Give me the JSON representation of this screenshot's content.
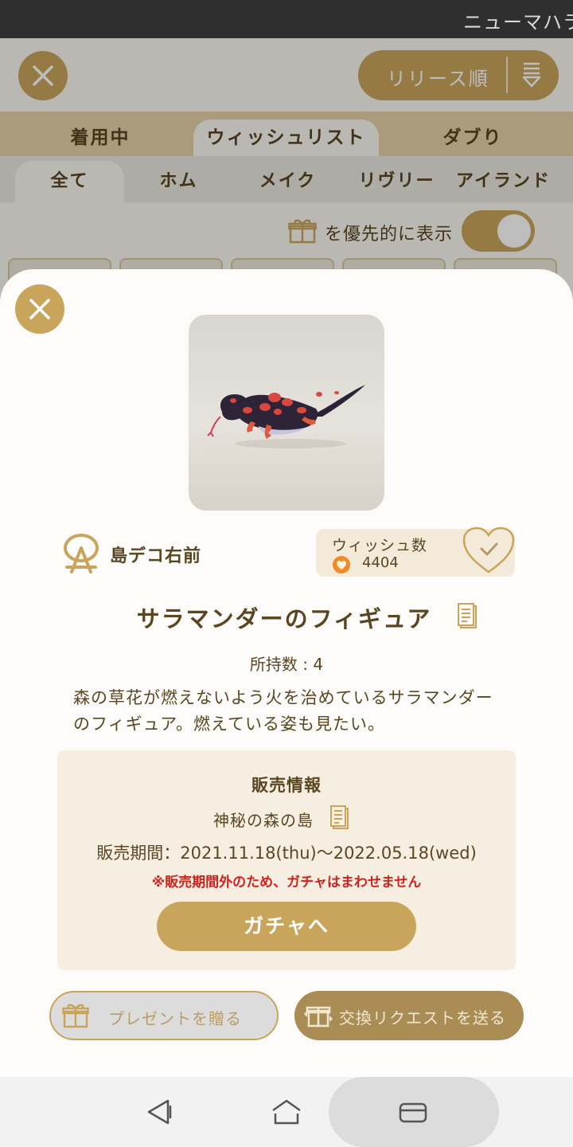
{
  "status_bar": {
    "text": "ニューマハラ"
  },
  "background": {
    "sort_label": "リリース順",
    "main_tabs": [
      {
        "label": "着用中"
      },
      {
        "label": "ウィッシュリスト"
      },
      {
        "label": "ダブり"
      }
    ],
    "sub_tabs": [
      {
        "label": "全て"
      },
      {
        "label": "ホム"
      },
      {
        "label": "メイク"
      },
      {
        "label": "リヴリー"
      },
      {
        "label": "アイランド"
      }
    ],
    "priority_label": "を優先的に表示",
    "priority_toggle_on": true
  },
  "item": {
    "category": "島デコ右前",
    "wish_label": "ウィッシュ数",
    "wish_count": "4404",
    "title": "サラマンダーのフィギュア",
    "owned": "所持数 : 4",
    "description": "森の草花が燃えないよう火を治めているサラマンダーのフィギュア。燃えている姿も見たい。"
  },
  "sale": {
    "heading": "販売情報",
    "place": "神秘の森の島",
    "period": "販売期間：2021.11.18(thu)〜2022.05.18(wed)",
    "warning": "※販売期間外のため、ガチャはまわせません",
    "gacha_button": "ガチャへ"
  },
  "actions": {
    "present": "プレゼントを贈る",
    "exchange": "交換リクエストを送る"
  },
  "colors": {
    "accent": "#c9a55b",
    "text": "#5a4621",
    "warning": "#d0231d"
  }
}
